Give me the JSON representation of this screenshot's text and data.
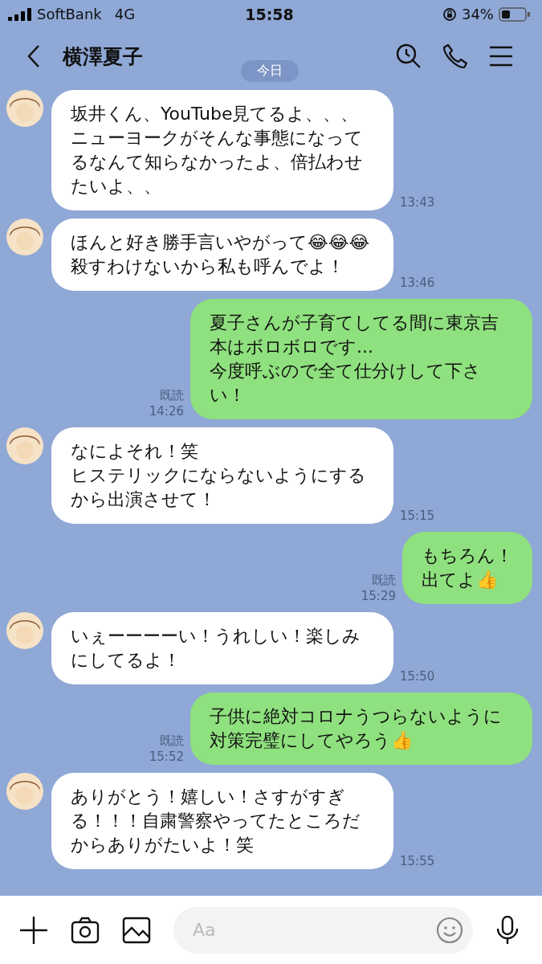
{
  "status_bar": {
    "carrier": "SoftBank",
    "network": "4G",
    "time": "15:58",
    "battery": "34%"
  },
  "header": {
    "title": "横澤夏子"
  },
  "date_label": "今日",
  "messages": [
    {
      "kind": "received",
      "lines": [
        "坂井くん、YouTube見てるよ、、、",
        "ニューヨークがそんな事態になってるなんて知らなかったよ、倍払わせたいよ、、"
      ],
      "time": "13:43"
    },
    {
      "kind": "received",
      "lines": [
        "ほんと好き勝手言いやがって😂😂😂殺すわけないから私も呼んでよ！"
      ],
      "time": "13:46"
    },
    {
      "kind": "sent",
      "lines": [
        "夏子さんが子育てしてる間に東京吉本はボロボロです...",
        "今度呼ぶので全て仕分けして下さい！"
      ],
      "time": "14:26",
      "read": "既読"
    },
    {
      "kind": "received",
      "lines": [
        "なによそれ！笑",
        "ヒステリックにならないようにするから出演させて！"
      ],
      "time": "15:15"
    },
    {
      "kind": "sent",
      "lines": [
        "もちろん！",
        "出てよ👍"
      ],
      "time": "15:29",
      "read": "既読"
    },
    {
      "kind": "received",
      "lines": [
        "いぇーーーーい！うれしい！楽しみにしてるよ！"
      ],
      "time": "15:50"
    },
    {
      "kind": "sent",
      "lines": [
        "子供に絶対コロナうつらないように対策完璧にしてやろう👍"
      ],
      "time": "15:52",
      "read": "既読"
    },
    {
      "kind": "received",
      "lines": [
        "ありがとう！嬉しい！さすがすぎる！！！自粛警察やってたところだからありがたいよ！笑"
      ],
      "time": "15:55"
    }
  ],
  "input": {
    "placeholder": "Aa"
  }
}
